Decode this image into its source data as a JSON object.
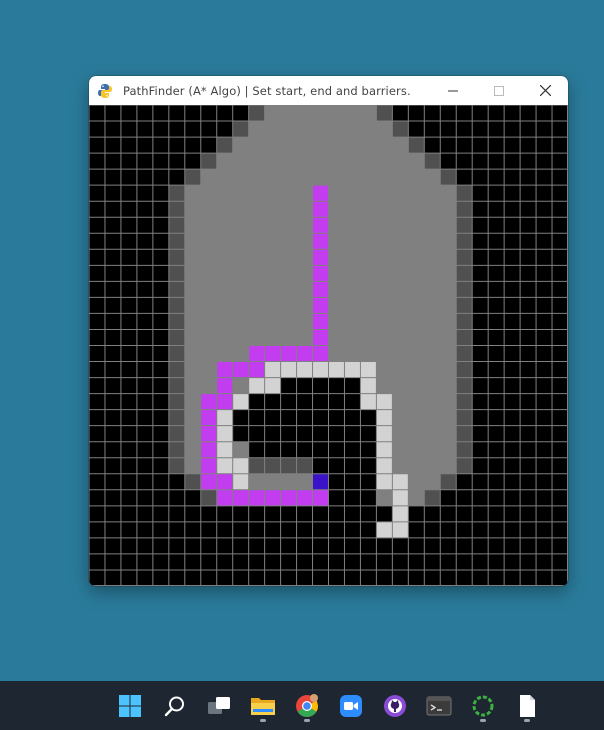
{
  "window": {
    "title": "PathFinder (A* Algo) | Set start, end and barriers.",
    "controls": {
      "minimize": "minimize",
      "maximize": "maximize",
      "close": "close"
    }
  },
  "grid": {
    "rows": 30,
    "cols": 30,
    "colors": {
      "empty": "#000000",
      "barrier": "#808080",
      "edge": "#505050",
      "closed": "#d3d3d3",
      "path": "#c23cf0",
      "end": "#3a12c8",
      "line": "#808080"
    },
    "barrier_cells": [
      "0:11-18",
      "1:10-19",
      "2:9-20",
      "3:8-21",
      "4:7-22",
      "5:6-23",
      "6:5-23",
      "7:5-23",
      "8:5-23",
      "9:5-23",
      "10:5-23",
      "11:5-23",
      "12:5-23",
      "13:5-23",
      "14:5-23",
      "15:5-23",
      "16:5-23",
      "17:5-23",
      "18:5-23",
      "19:5-23",
      "20:5-23",
      "21:5-23",
      "22:5-23",
      "23:6-22",
      "24:7-21"
    ],
    "edge_cells": [
      "0:10",
      "0:18",
      "1:9",
      "1:19",
      "2:8",
      "2:20",
      "3:7",
      "3:21",
      "4:6",
      "4:22",
      "5:5",
      "5:23",
      "6:5",
      "7:5",
      "8:5",
      "9:5",
      "10:5",
      "11:5",
      "12:5",
      "13:5",
      "14:5",
      "15:5",
      "16:5",
      "17:5",
      "18:5",
      "19:5",
      "20:5",
      "21:5",
      "22:5",
      "6:23",
      "7:23",
      "8:23",
      "9:23",
      "10:23",
      "11:23",
      "12:23",
      "13:23",
      "14:23",
      "15:23",
      "16:23",
      "17:23",
      "18:23",
      "19:23",
      "20:23",
      "21:23",
      "22:23",
      "23:6",
      "23:22",
      "24:7-14",
      "24:21",
      "22:10-13"
    ],
    "empty_cells": [
      "17:10-16",
      "18:9-16",
      "19:9-17",
      "20:9-17",
      "21:10-17",
      "22:14-17",
      "23:15-17",
      "24:15-17",
      "24:19",
      "25:18"
    ],
    "closed_cells": [
      "16:11-17",
      "17:10-11",
      "17:17",
      "18:9",
      "18:17-18",
      "19:8",
      "19:18",
      "20:8",
      "20:18",
      "21:8",
      "21:18",
      "22:8-9",
      "22:18",
      "23:9",
      "23:18-19",
      "24:19",
      "25:19",
      "26:18-19"
    ],
    "path_cells": [
      "5:14",
      "6:14",
      "7:14",
      "8:14",
      "9:14",
      "10:14",
      "11:14",
      "12:14",
      "13:14",
      "14:14",
      "15:10-14",
      "16:8-10",
      "17:8",
      "18:7-8",
      "19:7",
      "20:7",
      "21:7",
      "22:7",
      "23:7-8",
      "24:8-14"
    ],
    "end_cells": [
      "23:14"
    ]
  },
  "taskbar": {
    "items": [
      {
        "name": "start",
        "color": "#4cc2ff"
      },
      {
        "name": "search",
        "color": "#ffffff"
      },
      {
        "name": "task-view",
        "color": "#ffffff"
      },
      {
        "name": "file-explorer",
        "color": "#f5c242"
      },
      {
        "name": "chrome",
        "color": "#e8453c"
      },
      {
        "name": "zoom",
        "color": "#2d8cff"
      },
      {
        "name": "github-desktop",
        "color": "#8a4bd6"
      },
      {
        "name": "terminal",
        "color": "#2b2b2b"
      },
      {
        "name": "refresh-app",
        "color": "#4caf50"
      },
      {
        "name": "document",
        "color": "#ffffff"
      }
    ]
  }
}
